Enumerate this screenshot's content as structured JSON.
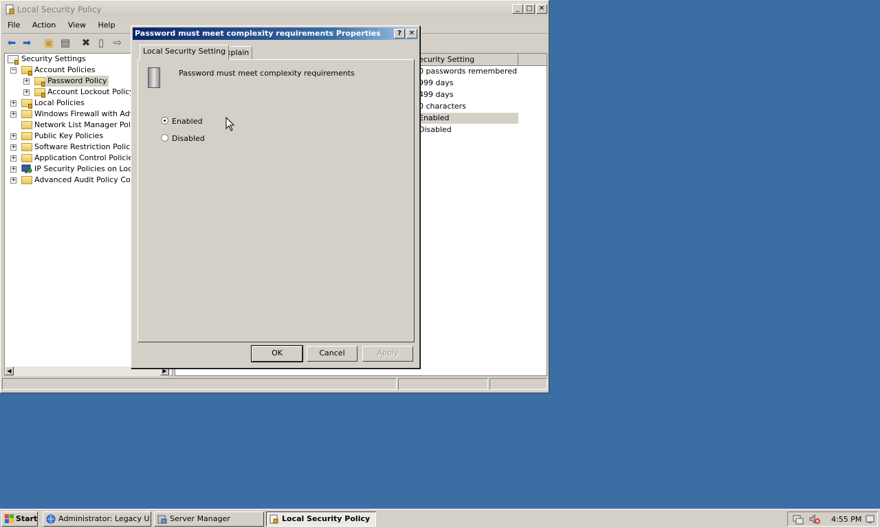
{
  "main_window": {
    "title": "Local Security Policy",
    "controls": {
      "minimize": "_",
      "maximize": "□",
      "close": "✕"
    }
  },
  "menu": [
    "File",
    "Action",
    "View",
    "Help"
  ],
  "tree": {
    "items": [
      {
        "label": "Security Settings"
      },
      {
        "label": "Account Policies",
        "expander": "−"
      },
      {
        "label": "Password Policy",
        "expander": "+"
      },
      {
        "label": "Account Lockout Policy",
        "expander": "+"
      },
      {
        "label": "Local Policies",
        "expander": "+"
      },
      {
        "label": "Windows Firewall with Advanc",
        "expander": "+"
      },
      {
        "label": "Network List Manager Policies"
      },
      {
        "label": "Public Key Policies",
        "expander": "+"
      },
      {
        "label": "Software Restriction Policies",
        "expander": "+"
      },
      {
        "label": "Application Control Policies",
        "expander": "+"
      },
      {
        "label": "IP Security Policies on Local C",
        "expander": "+"
      },
      {
        "label": "Advanced Audit Policy Configu",
        "expander": "+"
      }
    ]
  },
  "list": {
    "column": "ecurity Setting",
    "rows": [
      "0 passwords remembered",
      "999 days",
      "499 days",
      "0 characters",
      "Enabled",
      "Disabled"
    ]
  },
  "dialog": {
    "title": "Password must meet complexity requirements Properties",
    "help_btn": "?",
    "close_btn": "✕",
    "tabs": [
      "Local Security Setting",
      "Explain"
    ],
    "policy_name": "Password must meet complexity requirements",
    "options": {
      "enabled": "Enabled",
      "disabled": "Disabled",
      "selected": "Enabled"
    },
    "buttons": {
      "ok": "OK",
      "cancel": "Cancel",
      "apply": "Apply"
    }
  },
  "taskbar": {
    "start": "Start",
    "tasks": [
      "Administrator: Legacy U...",
      "Server Manager",
      "Local Security Policy"
    ],
    "clock": "4:55 PM"
  }
}
